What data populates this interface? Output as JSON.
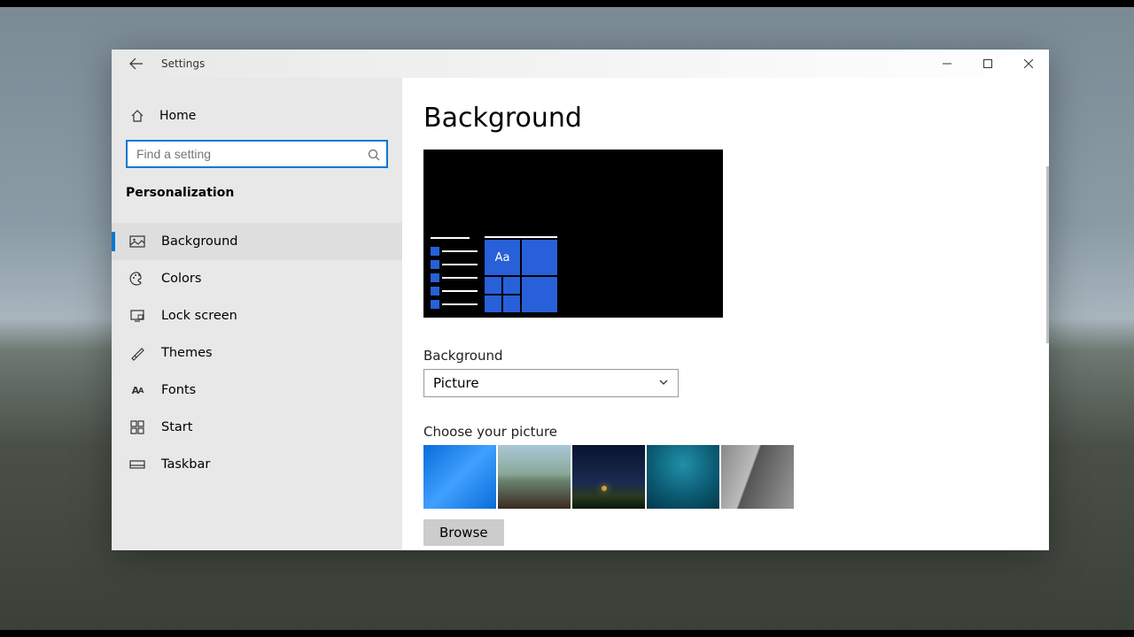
{
  "window": {
    "title": "Settings"
  },
  "sidebar": {
    "home_label": "Home",
    "search_placeholder": "Find a setting",
    "category": "Personalization",
    "items": [
      {
        "label": "Background",
        "icon": "picture"
      },
      {
        "label": "Colors",
        "icon": "palette"
      },
      {
        "label": "Lock screen",
        "icon": "lock-screen"
      },
      {
        "label": "Themes",
        "icon": "brush"
      },
      {
        "label": "Fonts",
        "icon": "fonts"
      },
      {
        "label": "Start",
        "icon": "start"
      },
      {
        "label": "Taskbar",
        "icon": "taskbar"
      }
    ],
    "selected_index": 0
  },
  "main": {
    "heading": "Background",
    "preview_aa": "Aa",
    "background_label": "Background",
    "background_value": "Picture",
    "choose_label": "Choose your picture",
    "browse_label": "Browse"
  }
}
